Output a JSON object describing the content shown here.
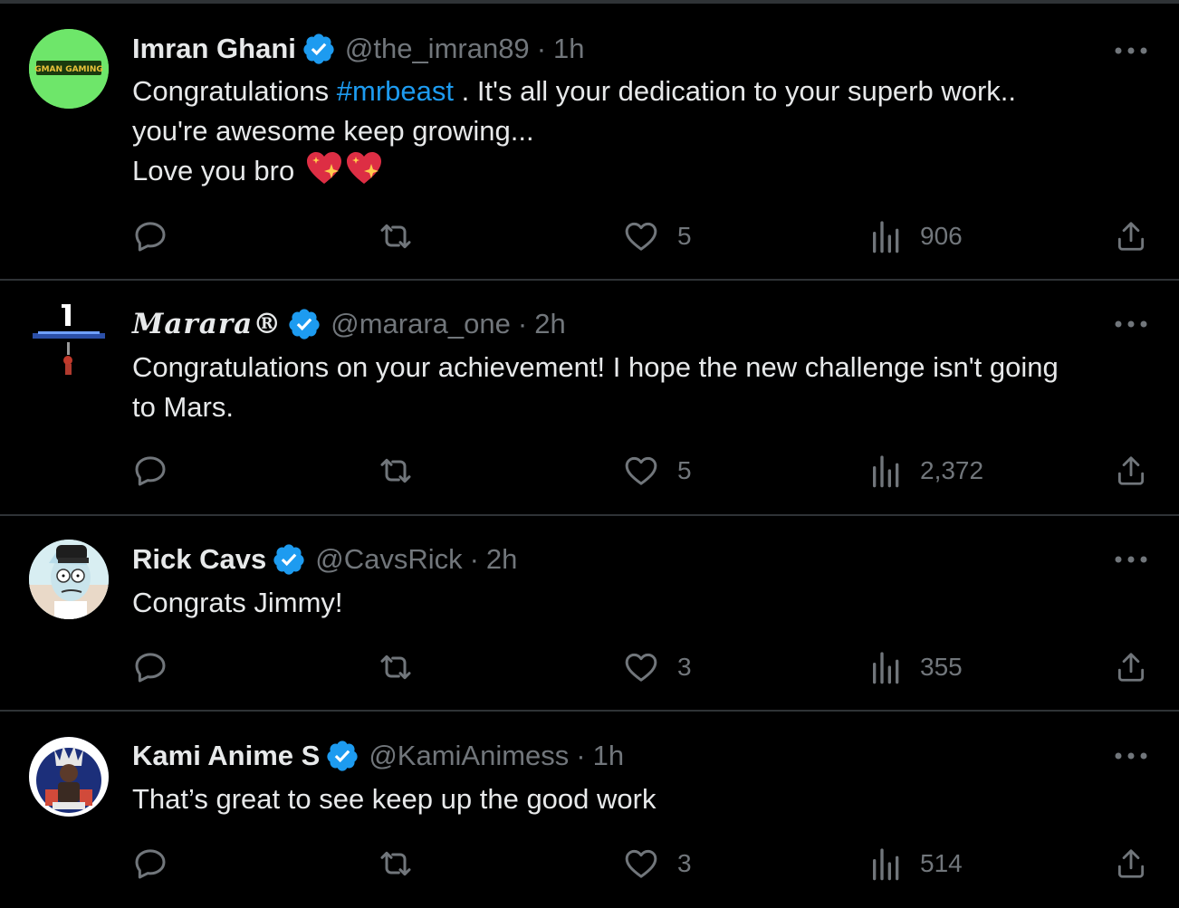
{
  "colors": {
    "background": "#000000",
    "text": "#e7e9ea",
    "muted": "#71767b",
    "link": "#1d9bf0",
    "verified": "#1d9bf0",
    "divider": "#2f3336"
  },
  "tweets": [
    {
      "name": "Imran Ghani",
      "handle": "@the_imran89",
      "separator": "·",
      "time": "1h",
      "avatar_text": "GMAN GAMING",
      "text": {
        "prefix": "Congratulations ",
        "hashtag": "#mrbeast",
        "suffix": " .  It's all your dedication to your superb work..",
        "line2": "you're awesome keep growing...",
        "line3": "Love you bro"
      },
      "emojis": [
        "sparkling-heart",
        "sparkling-heart"
      ],
      "likes": "5",
      "views": "906"
    },
    {
      "name": "Marara®",
      "handle": "@marara_one",
      "separator": "·",
      "time": "2h",
      "text": {
        "line1": "Congratulations on your achievement! I hope the new challenge isn't going",
        "line2": "to Mars."
      },
      "likes": "5",
      "views": "2,372"
    },
    {
      "name": "Rick Cavs",
      "handle": "@CavsRick",
      "separator": "·",
      "time": "2h",
      "text": {
        "line1": "Congrats Jimmy!"
      },
      "likes": "3",
      "views": "355"
    },
    {
      "name": "Kami Anime S",
      "handle": "@KamiAnimess",
      "separator": "·",
      "time": "1h",
      "text": {
        "line1": "That’s great to see keep up the good work"
      },
      "likes": "3",
      "views": "514"
    }
  ],
  "icons": {
    "reply": "reply-icon",
    "repost": "repost-icon",
    "like": "heart-icon",
    "views": "views-icon",
    "share": "share-icon",
    "more": "more-icon",
    "verified": "verified-badge-icon"
  }
}
